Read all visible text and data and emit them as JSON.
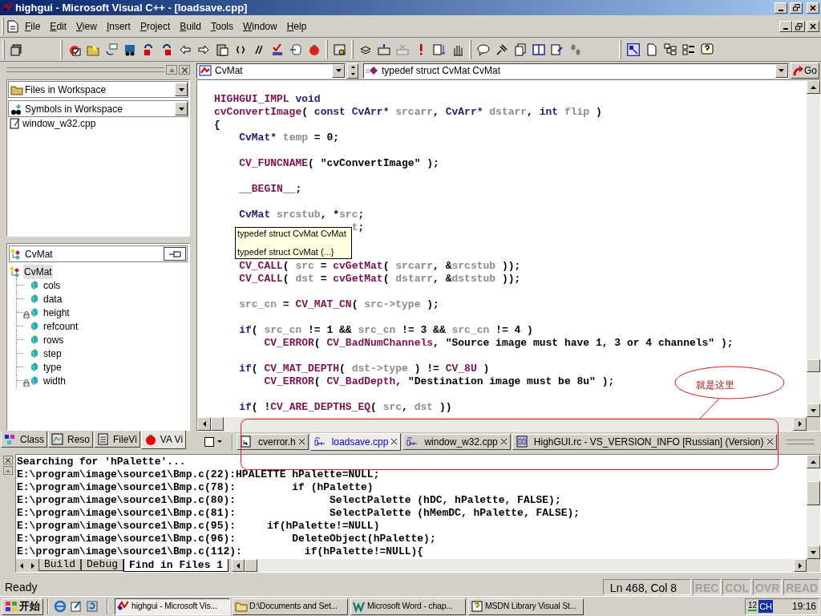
{
  "window": {
    "title": "highgui - Microsoft Visual C++ - [loadsave.cpp]"
  },
  "menu": [
    {
      "label": "File"
    },
    {
      "label": "Edit"
    },
    {
      "label": "View"
    },
    {
      "label": "Insert"
    },
    {
      "label": "Project"
    },
    {
      "label": "Build"
    },
    {
      "label": "Tools"
    },
    {
      "label": "Window"
    },
    {
      "label": "Help"
    }
  ],
  "navbar": {
    "class_combo": "CvMat",
    "member_combo": "typedef struct CvMat CvMat",
    "go_button": "Go"
  },
  "workspace": {
    "dropdowns": [
      "Files in Workspace",
      "Symbols in Workspace"
    ],
    "files": [
      "window_w32.cpp"
    ],
    "symbol_field": "CvMat",
    "tree": {
      "label": "CvMat",
      "children": [
        {
          "label": "cols",
          "locked": false
        },
        {
          "label": "data",
          "locked": false
        },
        {
          "label": "height",
          "locked": true
        },
        {
          "label": "refcount",
          "locked": false
        },
        {
          "label": "rows",
          "locked": false
        },
        {
          "label": "step",
          "locked": false
        },
        {
          "label": "type",
          "locked": false
        },
        {
          "label": "width",
          "locked": true
        }
      ]
    },
    "tabs": [
      {
        "label": "Class",
        "kind": "class",
        "selected": false
      },
      {
        "label": "Reso",
        "kind": "resource",
        "selected": false
      },
      {
        "label": "FileVi",
        "kind": "file",
        "selected": false
      },
      {
        "label": "VA Vi",
        "kind": "va",
        "selected": true
      }
    ]
  },
  "editor": {
    "lines": [
      {
        "blank_before": false,
        "tall_gap": false,
        "tokens": [
          {
            "kind": "macro",
            "text": "HIGHGUI_IMPL"
          },
          {
            "kind": "type",
            "text": " void"
          }
        ]
      },
      {
        "blank_before": false,
        "tall_gap": false,
        "tokens": [
          {
            "kind": "macro",
            "text": "cvConvertImage"
          },
          {
            "kind": "plain",
            "text": "( "
          },
          {
            "kind": "type",
            "text": "const CvArr*"
          },
          {
            "kind": "var",
            "text": " srcarr"
          },
          {
            "kind": "plain",
            "text": ", "
          },
          {
            "kind": "type",
            "text": "CvArr*"
          },
          {
            "kind": "var",
            "text": " dstarr"
          },
          {
            "kind": "plain",
            "text": ", "
          },
          {
            "kind": "type",
            "text": "int"
          },
          {
            "kind": "var",
            "text": " flip"
          },
          {
            "kind": "plain",
            "text": " )"
          }
        ]
      },
      {
        "blank_before": false,
        "tall_gap": false,
        "tokens": [
          {
            "kind": "plain",
            "text": "{"
          }
        ]
      },
      {
        "blank_before": false,
        "tall_gap": false,
        "tokens": [
          {
            "kind": "type",
            "text": "    CvMat*"
          },
          {
            "kind": "var",
            "text": " temp"
          },
          {
            "kind": "plain",
            "text": " = 0;"
          }
        ]
      },
      {
        "blank_before": true,
        "tall_gap": false,
        "tokens": [
          {
            "kind": "macro",
            "text": "    CV_FUNCNAME"
          },
          {
            "kind": "plain",
            "text": "( \"cvConvertImage\" );"
          }
        ]
      },
      {
        "blank_before": true,
        "tall_gap": false,
        "tokens": [
          {
            "kind": "macro",
            "text": "    __BEGIN__"
          },
          {
            "kind": "plain",
            "text": ";"
          }
        ]
      },
      {
        "blank_before": true,
        "tall_gap": false,
        "tokens": [
          {
            "kind": "type",
            "text": "    CvMat"
          },
          {
            "kind": "var",
            "text": " srcstub"
          },
          {
            "kind": "plain",
            "text": ", *"
          },
          {
            "kind": "var",
            "text": "src"
          },
          {
            "kind": "plain",
            "text": ";"
          }
        ]
      },
      {
        "blank_before": false,
        "tall_gap": false,
        "tokens": [
          {
            "kind": "var",
            "text": "                      t"
          },
          {
            "kind": "plain",
            "text": ";"
          }
        ]
      },
      {
        "blank_before": true,
        "tall_gap": true,
        "tokens": [
          {
            "kind": "macro",
            "text": "    CV_CALL"
          },
          {
            "kind": "plain",
            "text": "( "
          },
          {
            "kind": "var",
            "text": "src"
          },
          {
            "kind": "plain",
            "text": " = "
          },
          {
            "kind": "macro",
            "text": "cvGetMat"
          },
          {
            "kind": "plain",
            "text": "( "
          },
          {
            "kind": "var",
            "text": "srcarr"
          },
          {
            "kind": "plain",
            "text": ", &"
          },
          {
            "kind": "var",
            "text": "srcstub"
          },
          {
            "kind": "plain",
            "text": " ));"
          }
        ]
      },
      {
        "blank_before": false,
        "tall_gap": false,
        "tokens": [
          {
            "kind": "macro",
            "text": "    CV_CALL"
          },
          {
            "kind": "plain",
            "text": "( "
          },
          {
            "kind": "var",
            "text": "dst"
          },
          {
            "kind": "plain",
            "text": " = "
          },
          {
            "kind": "macro",
            "text": "cvGetMat"
          },
          {
            "kind": "plain",
            "text": "( "
          },
          {
            "kind": "var",
            "text": "dstarr"
          },
          {
            "kind": "plain",
            "text": ", &"
          },
          {
            "kind": "var",
            "text": "dststub"
          },
          {
            "kind": "plain",
            "text": " ));"
          }
        ]
      },
      {
        "blank_before": true,
        "tall_gap": false,
        "tokens": [
          {
            "kind": "var",
            "text": "    src_cn"
          },
          {
            "kind": "plain",
            "text": " = "
          },
          {
            "kind": "macro",
            "text": "CV_MAT_CN"
          },
          {
            "kind": "plain",
            "text": "( "
          },
          {
            "kind": "var",
            "text": "src->type"
          },
          {
            "kind": "plain",
            "text": " );"
          }
        ]
      },
      {
        "blank_before": true,
        "tall_gap": false,
        "tokens": [
          {
            "kind": "type",
            "text": "    if"
          },
          {
            "kind": "plain",
            "text": "( "
          },
          {
            "kind": "var",
            "text": "src_cn"
          },
          {
            "kind": "plain",
            "text": " != 1 && "
          },
          {
            "kind": "var",
            "text": "src_cn"
          },
          {
            "kind": "plain",
            "text": " != 3 && "
          },
          {
            "kind": "var",
            "text": "src_cn"
          },
          {
            "kind": "plain",
            "text": " != 4 )"
          }
        ]
      },
      {
        "blank_before": false,
        "tall_gap": false,
        "tokens": [
          {
            "kind": "macro",
            "text": "        CV_ERROR"
          },
          {
            "kind": "plain",
            "text": "( "
          },
          {
            "kind": "macro",
            "text": "CV_BadNumChannels"
          },
          {
            "kind": "plain",
            "text": ", \"Source image must have 1, 3 or 4 channels\" );"
          }
        ]
      },
      {
        "blank_before": true,
        "tall_gap": false,
        "tokens": [
          {
            "kind": "type",
            "text": "    if"
          },
          {
            "kind": "plain",
            "text": "( "
          },
          {
            "kind": "macro",
            "text": "CV_MAT_DEPTH"
          },
          {
            "kind": "plain",
            "text": "( "
          },
          {
            "kind": "var",
            "text": "dst->type"
          },
          {
            "kind": "plain",
            "text": " ) != "
          },
          {
            "kind": "macro",
            "text": "CV_8U"
          },
          {
            "kind": "plain",
            "text": " )"
          }
        ]
      },
      {
        "blank_before": false,
        "tall_gap": false,
        "tokens": [
          {
            "kind": "macro",
            "text": "        CV_ERROR"
          },
          {
            "kind": "plain",
            "text": "( "
          },
          {
            "kind": "macro",
            "text": "CV_BadDepth"
          },
          {
            "kind": "plain",
            "text": ", \"Destination image must be 8u\" );"
          }
        ]
      },
      {
        "blank_before": true,
        "tall_gap": false,
        "tokens": [
          {
            "kind": "type",
            "text": "    if"
          },
          {
            "kind": "plain",
            "text": "( !"
          },
          {
            "kind": "macro",
            "text": "CV_ARE_DEPTHS_EQ"
          },
          {
            "kind": "plain",
            "text": "( "
          },
          {
            "kind": "var",
            "text": "src"
          },
          {
            "kind": "plain",
            "text": ", "
          },
          {
            "kind": "var",
            "text": "dst"
          },
          {
            "kind": "plain",
            "text": " ))"
          }
        ]
      }
    ],
    "tooltip": [
      "typedef struct CvMat CvMat",
      "typedef struct CvMat {...}"
    ],
    "file_tabs": [
      {
        "label": "cverror.h",
        "kind": "h",
        "selected": false
      },
      {
        "label": "loadsave.cpp",
        "kind": "cpp",
        "selected": true
      },
      {
        "label": "window_w32.cpp",
        "kind": "cpp",
        "selected": false
      },
      {
        "label": "HighGUI.rc - VS_VERSION_INFO [Russian] (Version)",
        "kind": "rc",
        "selected": false
      }
    ]
  },
  "annotation": {
    "text": "就是这里"
  },
  "output": {
    "lines": [
      "Searching for 'hPalette'...",
      "E:\\program\\image\\source1\\Bmp.c(22):HPALETTE hPalette=NULL;",
      "E:\\program\\image\\source1\\Bmp.c(78):         if (hPalette)",
      "E:\\program\\image\\source1\\Bmp.c(80):               SelectPalette (hDC, hPalette, FALSE);",
      "E:\\program\\image\\source1\\Bmp.c(81):               SelectPalette (hMemDC, hPalette, FALSE);",
      "E:\\program\\image\\source1\\Bmp.c(95):     if(hPalette!=NULL)",
      "E:\\program\\image\\source1\\Bmp.c(96):         DeleteObject(hPalette);",
      "E:\\program\\image\\source1\\Bmp.c(112):          if(hPalette!=NULL){"
    ],
    "tabs": [
      {
        "label": "Build",
        "selected": false
      },
      {
        "label": "Debug",
        "selected": false
      },
      {
        "label": "Find in Files 1",
        "selected": true
      }
    ]
  },
  "status_bar": {
    "message": "Ready",
    "position": "Ln 468, Col 8",
    "indicators": [
      {
        "label": "REC",
        "enabled": false
      },
      {
        "label": "COL",
        "enabled": false
      },
      {
        "label": "OVR",
        "enabled": false
      },
      {
        "label": "READ",
        "enabled": false
      }
    ]
  },
  "taskbar": {
    "start": "开始",
    "tasks": [
      {
        "label": "highgui - Microsoft Vis...",
        "kind": "vc",
        "selected": true
      },
      {
        "label": "D:\\Documents and Set...",
        "kind": "folder",
        "selected": false
      },
      {
        "label": "Microsoft Word - chap...",
        "kind": "word",
        "selected": false
      },
      {
        "label": "MSDN Library Visual St...",
        "kind": "help",
        "selected": false
      }
    ],
    "tray": {
      "date": "12",
      "input": "CH",
      "clock": "19:16"
    }
  }
}
